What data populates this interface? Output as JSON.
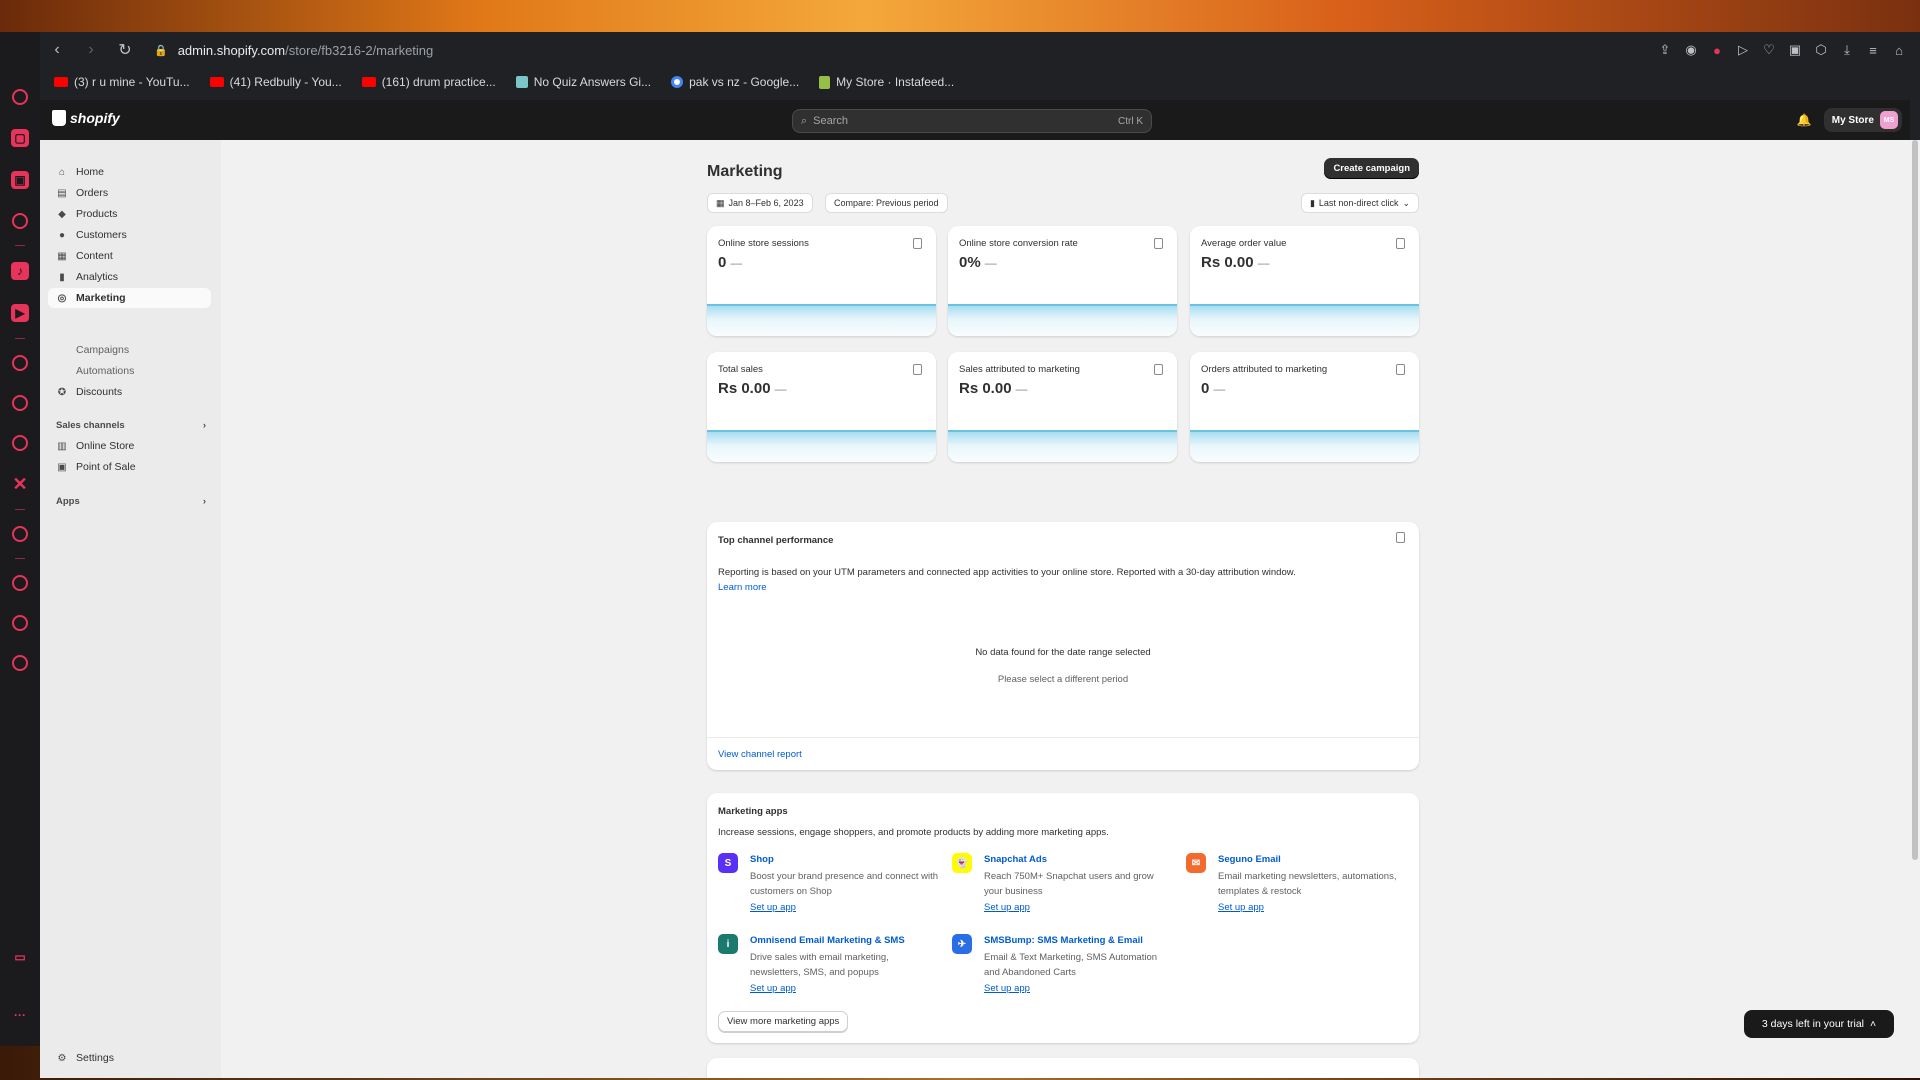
{
  "browser": {
    "url_host": "admin.shopify.com",
    "url_path": "/store/fb3216-2/marketing",
    "bookmarks": [
      {
        "label": "(3) r u mine - YouTu...",
        "icon": "youtube-icon"
      },
      {
        "label": "(41) Redbully - You...",
        "icon": "youtube-icon"
      },
      {
        "label": "(161) drum practice...",
        "icon": "youtube-icon"
      },
      {
        "label": "No Quiz Answers Gi...",
        "icon": "quiz-icon"
      },
      {
        "label": "pak vs nz - Google...",
        "icon": "google-icon"
      },
      {
        "label": "My Store · Instafeed...",
        "icon": "shopify-icon"
      }
    ]
  },
  "topbar": {
    "logo": "shopify",
    "search_placeholder": "Search",
    "search_shortcut": "Ctrl K",
    "store_name": "My Store",
    "avatar_initials": "MS"
  },
  "sidebar": {
    "items": [
      {
        "label": "Home",
        "icon": "home-icon"
      },
      {
        "label": "Orders",
        "icon": "orders-icon"
      },
      {
        "label": "Products",
        "icon": "tag-icon"
      },
      {
        "label": "Customers",
        "icon": "person-icon"
      },
      {
        "label": "Content",
        "icon": "content-icon"
      },
      {
        "label": "Analytics",
        "icon": "bar-chart-icon"
      },
      {
        "label": "Marketing",
        "icon": "target-icon"
      }
    ],
    "marketing_sub": [
      "Campaigns",
      "Automations"
    ],
    "discounts": "Discounts",
    "sales_channels_label": "Sales channels",
    "channels": [
      "Online Store",
      "Point of Sale"
    ],
    "apps_label": "Apps",
    "settings": "Settings"
  },
  "page": {
    "title": "Marketing",
    "create_button": "Create campaign",
    "date_range": "Jan 8–Feb 6, 2023",
    "compare": "Compare: Previous period",
    "attribution": "Last non-direct click"
  },
  "metrics": [
    {
      "label": "Online store sessions",
      "value": "0",
      "trend": "—"
    },
    {
      "label": "Online store conversion rate",
      "value": "0%",
      "trend": "—"
    },
    {
      "label": "Average order value",
      "value": "Rs 0.00",
      "trend": "—"
    },
    {
      "label": "Total sales",
      "value": "Rs 0.00",
      "trend": "—"
    },
    {
      "label": "Sales attributed to marketing",
      "value": "Rs 0.00",
      "trend": "—"
    },
    {
      "label": "Orders attributed to marketing",
      "value": "0",
      "trend": "—"
    }
  ],
  "top_channel": {
    "title": "Top channel performance",
    "description": "Reporting is based on your UTM parameters and connected app activities to your online store. Reported with a 30-day attribution window.",
    "learn_more": "Learn more",
    "empty_title": "No data found for the date range selected",
    "empty_sub": "Please select a different period",
    "view_report": "View channel report"
  },
  "marketing_apps": {
    "title": "Marketing apps",
    "description": "Increase sessions, engage shoppers, and promote products by adding more marketing apps.",
    "apps": [
      {
        "name": "Shop",
        "desc": "Boost your brand presence and connect with customers on Shop",
        "cta": "Set up app",
        "icon_color": "#5a31f4",
        "glyph": "S"
      },
      {
        "name": "Snapchat Ads",
        "desc": "Reach 750M+ Snapchat users and grow your business",
        "cta": "Set up app",
        "icon_color": "#fffc00",
        "glyph": "👻"
      },
      {
        "name": "Seguno Email",
        "desc": "Email marketing newsletters, automations, templates & restock",
        "cta": "Set up app",
        "icon_color": "#f26a2e",
        "glyph": "✉"
      },
      {
        "name": "Omnisend Email Marketing & SMS",
        "desc": "Drive sales with email marketing, newsletters, SMS, and popups",
        "cta": "Set up app",
        "icon_color": "#1a7a6e",
        "glyph": "i"
      },
      {
        "name": "SMSBump: SMS Marketing & Email",
        "desc": "Email & Text Marketing, SMS Automation and Abandoned Carts",
        "cta": "Set up app",
        "icon_color": "#2a6ee6",
        "glyph": "✈"
      }
    ],
    "view_more": "View more marketing apps"
  },
  "trial_banner": "3 days left in your trial"
}
